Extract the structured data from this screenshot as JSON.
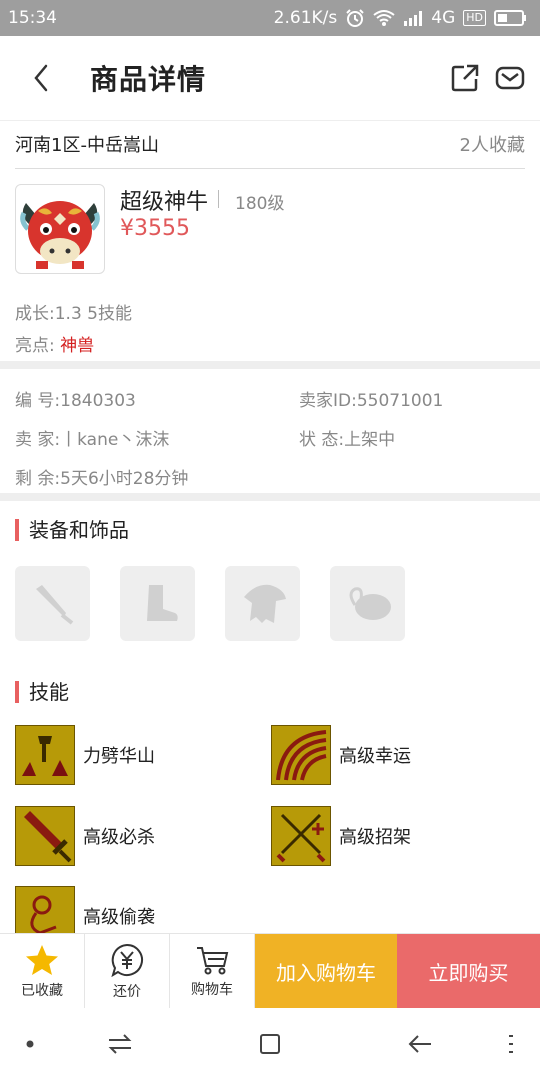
{
  "status_bar": {
    "time": "15:34",
    "network_speed": "2.61K/s",
    "network_type": "4G",
    "hd_label": "HD",
    "icons": [
      "alarm-icon",
      "wifi-icon",
      "signal-icon",
      "battery-icon"
    ]
  },
  "header": {
    "title": "商品详情",
    "icons": [
      "back-icon",
      "share-icon",
      "mail-icon"
    ]
  },
  "listing": {
    "server": "河南1区-中岳嵩山",
    "favorites": "2人收藏"
  },
  "pet": {
    "name": "超级神牛",
    "level": "180级",
    "price": "¥3555",
    "growth": "成长:1.3 5技能",
    "highlight_label": "亮点:",
    "highlight_value": "神兽"
  },
  "info": {
    "id_label": "编  号:",
    "id_value": "1840303",
    "seller_id_label": "卖家ID:",
    "seller_id_value": "55071001",
    "seller_label": "卖  家:",
    "seller_value": "丨kane丶沫沫",
    "status_label": "状  态:",
    "status_value": "上架中",
    "remaining_label": "剩  余:",
    "remaining_value": "5天6小时28分钟"
  },
  "equipment": {
    "title": "装备和饰品",
    "slots": [
      "weapon-icon",
      "boots-icon",
      "armor-icon",
      "accessory-icon"
    ]
  },
  "skills": {
    "title": "技能",
    "items": [
      {
        "name": "力劈华山"
      },
      {
        "name": "高级幸运"
      },
      {
        "name": "高级必杀"
      },
      {
        "name": "高级招架"
      },
      {
        "name": "高级偷袭"
      }
    ]
  },
  "bottom_bar": {
    "favorited": "已收藏",
    "bargain": "还价",
    "cart": "购物车",
    "add_to_cart": "加入购物车",
    "buy_now": "立即购买"
  },
  "colors": {
    "accent_red": "#e0585a",
    "cart_button": "#f0b225",
    "buy_button": "#ea6a6a",
    "star": "#f5b800"
  }
}
